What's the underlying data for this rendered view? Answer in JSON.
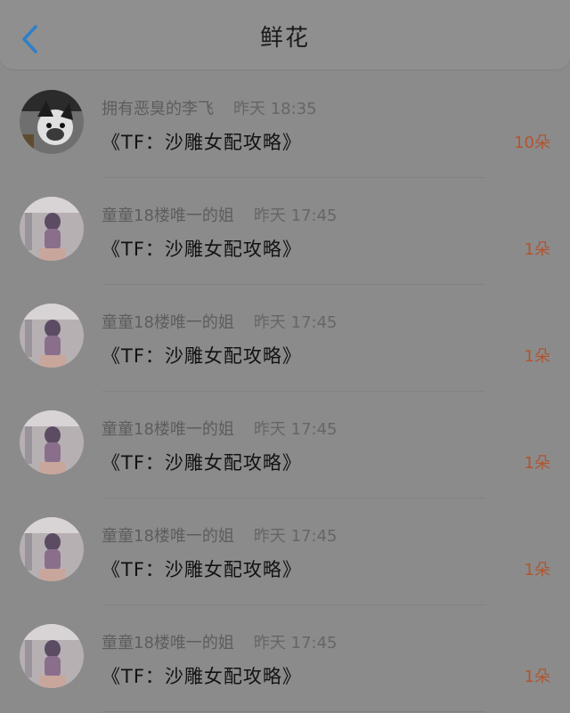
{
  "header": {
    "title": "鲜花",
    "back_icon": "chevron-left-icon",
    "accent_color": "#2f7fc8"
  },
  "rows": [
    {
      "user": "拥有恶臭的李飞",
      "time": "昨天 18:35",
      "book": "《TF：沙雕女配攻略》",
      "count": "10朵",
      "avatar": "dog"
    },
    {
      "user": "童童18楼唯一的姐",
      "time": "昨天 17:45",
      "book": "《TF：沙雕女配攻略》",
      "count": "1朵",
      "avatar": "girl"
    },
    {
      "user": "童童18楼唯一的姐",
      "time": "昨天 17:45",
      "book": "《TF：沙雕女配攻略》",
      "count": "1朵",
      "avatar": "girl"
    },
    {
      "user": "童童18楼唯一的姐",
      "time": "昨天 17:45",
      "book": "《TF：沙雕女配攻略》",
      "count": "1朵",
      "avatar": "girl"
    },
    {
      "user": "童童18楼唯一的姐",
      "time": "昨天 17:45",
      "book": "《TF：沙雕女配攻略》",
      "count": "1朵",
      "avatar": "girl"
    },
    {
      "user": "童童18楼唯一的姐",
      "time": "昨天 17:45",
      "book": "《TF：沙雕女配攻略》",
      "count": "1朵",
      "avatar": "girl"
    }
  ],
  "colors": {
    "count": "#b3542e",
    "name": "#5d5d5d",
    "book": "#121212",
    "background": "#8b8b8b"
  }
}
